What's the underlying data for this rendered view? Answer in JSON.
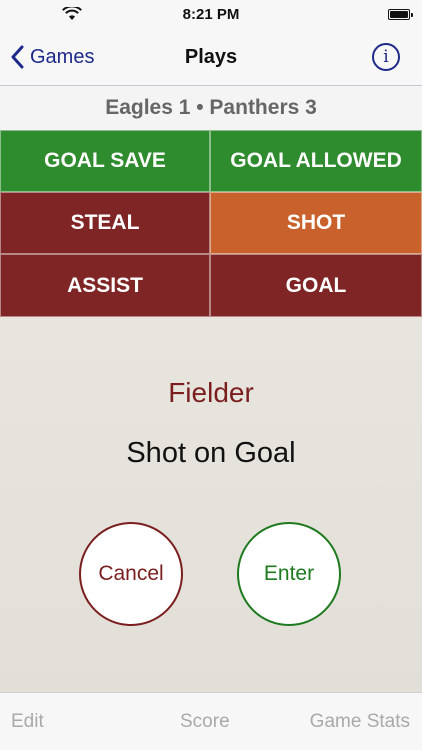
{
  "status_bar": {
    "time": "8:21 PM",
    "icons": [
      "wifi-icon",
      "battery-icon"
    ]
  },
  "nav": {
    "back_label": "Games",
    "title": "Plays",
    "info_label": "i",
    "back_icon": "chevron-left-icon"
  },
  "score_line": "Eagles 1 • Panthers 3",
  "plays": [
    {
      "label": "GOAL SAVE",
      "color": "#2e8b2e"
    },
    {
      "label": "GOAL ALLOWED",
      "color": "#2e8b2e"
    },
    {
      "label": "STEAL",
      "color": "#7f2525"
    },
    {
      "label": "SHOT",
      "color": "#c8612b"
    },
    {
      "label": "ASSIST",
      "color": "#7f2525"
    },
    {
      "label": "GOAL",
      "color": "#7f2525"
    }
  ],
  "selection": {
    "role": "Fielder",
    "play": "Shot on Goal"
  },
  "actions": {
    "cancel_label": "Cancel",
    "enter_label": "Enter"
  },
  "tabs": {
    "edit": "Edit",
    "score": "Score",
    "stats": "Game Stats"
  },
  "colors": {
    "accent": "#1d2a8a",
    "cancel": "#7a1e1e",
    "enter": "#1e7a1e"
  }
}
